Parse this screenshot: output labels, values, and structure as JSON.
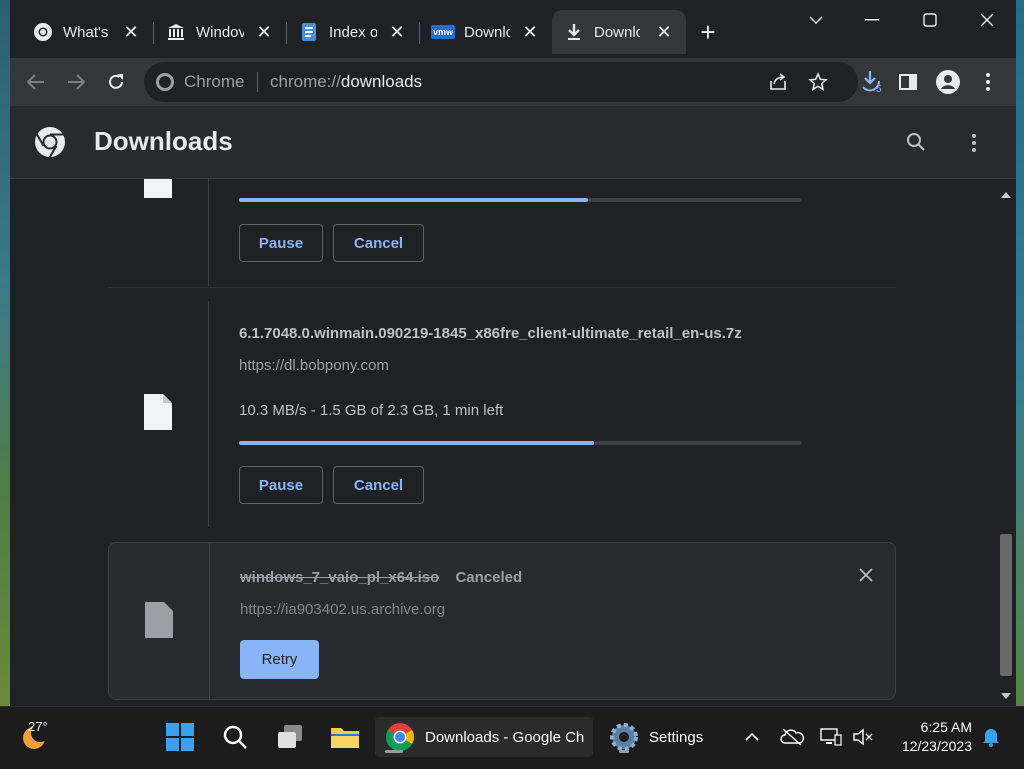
{
  "tabs": [
    {
      "title": "What's",
      "icon": "chrome-icon"
    },
    {
      "title": "Windov",
      "icon": "archive-icon"
    },
    {
      "title": "Index o",
      "icon": "document-icon"
    },
    {
      "title": "Downlc",
      "icon": "vmware-icon",
      "icon_text": "vmw"
    },
    {
      "title": "Downlc",
      "icon": "download-icon",
      "active": true
    }
  ],
  "address_bar": {
    "chip_label": "Chrome",
    "scheme": "chrome://",
    "host": "downloads"
  },
  "extension_badge": "5",
  "page": {
    "title": "Downloads"
  },
  "downloads": [
    {
      "progress": 0.62,
      "pause_label": "Pause",
      "cancel_label": "Cancel"
    },
    {
      "filename": "6.1.7048.0.winmain.090219-1845_x86fre_client-ultimate_retail_en-us.7z",
      "url": "https://dl.bobpony.com",
      "status": "10.3 MB/s - 1.5 GB of 2.3 GB, 1 min left",
      "progress": 0.63,
      "pause_label": "Pause",
      "cancel_label": "Cancel"
    },
    {
      "filename": "windows_7_vaio_pl_x64.iso",
      "state": "Canceled",
      "url": "https://ia903402.us.archive.org",
      "retry_label": "Retry"
    }
  ],
  "taskbar": {
    "weather_temp": "27°",
    "chrome_window_label": "Downloads - Google Ch",
    "settings_label": "Settings",
    "time": "6:25 AM",
    "date": "12/23/2023"
  },
  "colors": {
    "accent": "#8ab4f8",
    "background": "#202124",
    "toolbar": "#35363a"
  }
}
